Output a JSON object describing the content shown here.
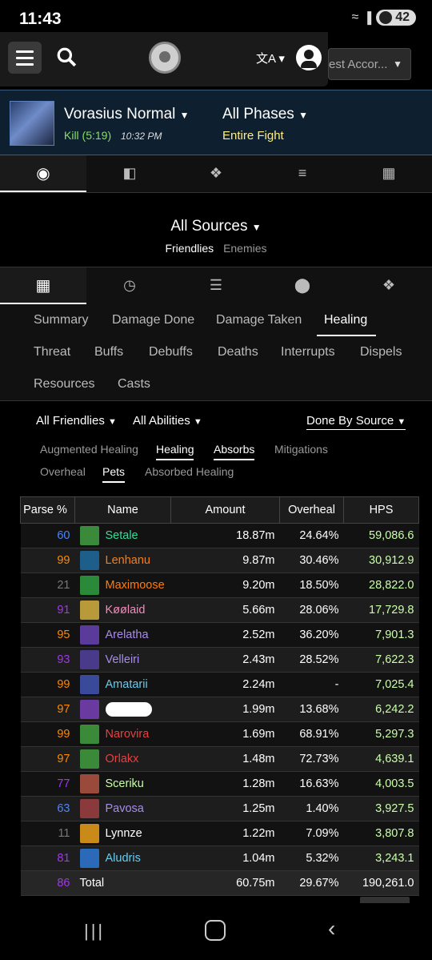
{
  "status": {
    "time": "11:43",
    "battery": "42"
  },
  "nav": {
    "account_text": "est Accor..."
  },
  "fight": {
    "boss": "Vorasius Normal",
    "kill": "Kill (5:19)",
    "time": "10:32 PM",
    "phases": "All Phases",
    "phase_sub": "Entire Fight"
  },
  "sources": {
    "label": "All Sources",
    "friendlies": "Friendlies",
    "enemies": "Enemies"
  },
  "subtabs": [
    [
      "Summary",
      "Damage Done",
      "Damage Taken",
      "Healing"
    ],
    [
      "Threat",
      "Buffs",
      "Debuffs",
      "Deaths",
      "Interrupts",
      "Dispels"
    ],
    [
      "Resources",
      "Casts"
    ]
  ],
  "filters": {
    "friendlies": "All Friendlies",
    "abilities": "All Abilities",
    "done_by": "Done By Source"
  },
  "options": [
    "Augmented Healing",
    "Healing",
    "Absorbs",
    "Mitigations",
    "Overheal",
    "Pets",
    "Absorbed Healing"
  ],
  "table": {
    "headers": [
      "Parse %",
      "Name",
      "Amount",
      "Overheal",
      "HPS"
    ],
    "rows": [
      {
        "parse": "60",
        "name": "Setale",
        "amount": "18.87m",
        "overheal": "24.64%",
        "hps": "59,086.6",
        "pcolor": "#4a86ff",
        "ncolor": "#33dd99",
        "icon": "#3b8a3b"
      },
      {
        "parse": "99",
        "name": "Lenhanu",
        "amount": "9.87m",
        "overheal": "30.46%",
        "hps": "30,912.9",
        "pcolor": "#ff8800",
        "ncolor": "#ff7c0a",
        "icon": "#1e5e8a"
      },
      {
        "parse": "21",
        "name": "Maximoose",
        "amount": "9.20m",
        "overheal": "18.50%",
        "hps": "28,822.0",
        "pcolor": "#777777",
        "ncolor": "#ff7c0a",
        "icon": "#2a8a3a"
      },
      {
        "parse": "91",
        "name": "Køølaid",
        "amount": "5.66m",
        "overheal": "28.06%",
        "hps": "17,729.8",
        "pcolor": "#a335ee",
        "ncolor": "#f48cba",
        "icon": "#b89a3a"
      },
      {
        "parse": "95",
        "name": "Arelatha",
        "amount": "2.52m",
        "overheal": "36.20%",
        "hps": "7,901.3",
        "pcolor": "#ff8800",
        "ncolor": "#a78bf0",
        "icon": "#5a3a9a"
      },
      {
        "parse": "93",
        "name": "Velleiri",
        "amount": "2.43m",
        "overheal": "28.52%",
        "hps": "7,622.3",
        "pcolor": "#a335ee",
        "ncolor": "#a78bf0",
        "icon": "#4a3a8a"
      },
      {
        "parse": "99",
        "name": "Amatarii",
        "amount": "2.24m",
        "overheal": "-",
        "hps": "7,025.4",
        "pcolor": "#ff8800",
        "ncolor": "#68ccef",
        "icon": "#3a4a9a"
      },
      {
        "parse": "97",
        "name": "",
        "amount": "1.99m",
        "overheal": "13.68%",
        "hps": "6,242.2",
        "pcolor": "#ff8800",
        "ncolor": "#ffffff",
        "icon": "#6a3aa0"
      },
      {
        "parse": "99",
        "name": "Narovira",
        "amount": "1.69m",
        "overheal": "68.91%",
        "hps": "5,297.3",
        "pcolor": "#ff8800",
        "ncolor": "#e84040",
        "icon": "#3a8a3a"
      },
      {
        "parse": "97",
        "name": "Orlakx",
        "amount": "1.48m",
        "overheal": "72.73%",
        "hps": "4,639.1",
        "pcolor": "#ff8800",
        "ncolor": "#e84040",
        "icon": "#3a8a3a"
      },
      {
        "parse": "77",
        "name": "Sceriku",
        "amount": "1.28m",
        "overheal": "16.63%",
        "hps": "4,003.5",
        "pcolor": "#a335ee",
        "ncolor": "#c9ffa8",
        "icon": "#9a4a3a"
      },
      {
        "parse": "63",
        "name": "Pavosa",
        "amount": "1.25m",
        "overheal": "1.40%",
        "hps": "3,927.5",
        "pcolor": "#4a86ff",
        "ncolor": "#a78bf0",
        "icon": "#8a3a3a"
      },
      {
        "parse": "11",
        "name": "Lynnze",
        "amount": "1.22m",
        "overheal": "7.09%",
        "hps": "3,807.8",
        "pcolor": "#777777",
        "ncolor": "#ffffff",
        "icon": "#c98a1a"
      },
      {
        "parse": "81",
        "name": "Aludris",
        "amount": "1.04m",
        "overheal": "5.32%",
        "hps": "3,243.1",
        "pcolor": "#a335ee",
        "ncolor": "#68ccef",
        "icon": "#2a6ab8"
      }
    ],
    "total": {
      "parse": "86",
      "name": "Total",
      "amount": "60.75m",
      "overheal": "29.67%",
      "hps": "190,261.0",
      "pcolor": "#a335ee"
    }
  }
}
